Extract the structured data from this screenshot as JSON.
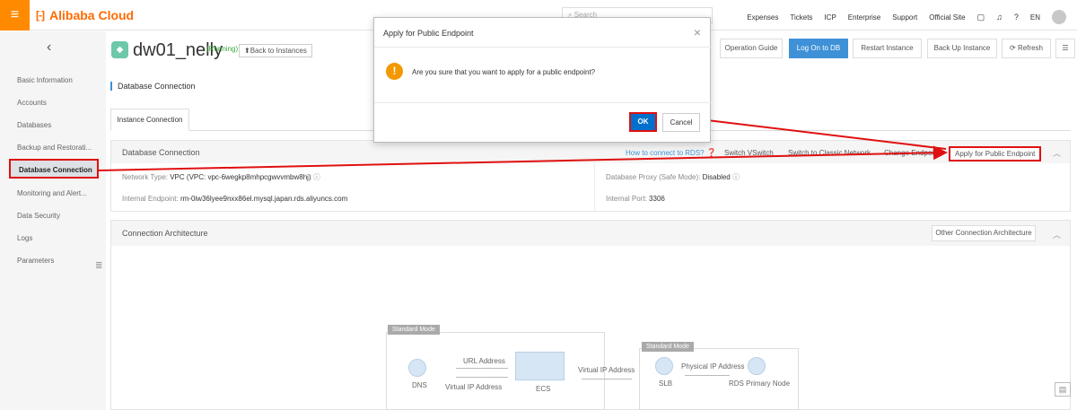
{
  "top": {
    "menu_glyph": "≡",
    "brand": "Alibaba Cloud",
    "brand_mark": "[-]",
    "search_placeholder": "Search",
    "nav": [
      "Expenses",
      "Tickets",
      "ICP",
      "Enterprise",
      "Support",
      "Official Site"
    ],
    "lang": "EN"
  },
  "sidebar": {
    "back_glyph": "‹",
    "items": [
      "Basic Information",
      "Accounts",
      "Databases",
      "Backup and Restorati...",
      "Database Connection",
      "Monitoring and Alert...",
      "Data Security",
      "Logs",
      "Parameters"
    ],
    "list_glyph": "≣"
  },
  "instance": {
    "name": "dw01_nelly",
    "status": "(Running)",
    "back_label": "⬆Back to Instances"
  },
  "toolbar": {
    "guide": "Operation Guide",
    "logon": "Log On to DB",
    "restart": "Restart Instance",
    "backup": "Back Up Instance",
    "refresh": "⟳ Refresh",
    "more": "☰"
  },
  "page": {
    "section_title": "Database Connection",
    "tab": "Instance Connection"
  },
  "db_panel": {
    "title": "Database Connection",
    "how_to": "How to connect to RDS?",
    "switch_vswitch": "Switch VSwitch",
    "switch_classic": "Switch to Classic Network",
    "change_endpoint": "Change Endpoint",
    "apply_public": "Apply for Public Endpoint",
    "network_type_label": "Network Type:",
    "network_type_value": "VPC",
    "vpc_value": "(VPC:  vpc-6wegkp8mhpcgwvvmbw8hj)",
    "proxy_label": "Database Proxy (Safe Mode):",
    "proxy_value": "Disabled",
    "internal_endpoint_label": "Internal Endpoint:",
    "internal_endpoint_value": "rm-0iw36lyee9nxx86el.mysql.japan.rds.aliyuncs.com",
    "internal_port_label": "Internal Port:",
    "internal_port_value": "3306"
  },
  "arch_panel": {
    "title": "Connection Architecture",
    "other": "Other Connection Architecture",
    "standard_mode_left": "Standard Mode",
    "standard_mode_right": "Standard Mode",
    "dns": "DNS",
    "url_address": "URL Address",
    "virtual_ip_left": "Virtual IP Address",
    "ecs": "ECS",
    "virtual_ip_right": "Virtual IP Address",
    "slb": "SLB",
    "physical_ip": "Physical IP Address",
    "rds_primary": "RDS Primary Node"
  },
  "modal": {
    "title": "Apply for Public Endpoint",
    "message": "Are you sure that you want to apply for a public endpoint?",
    "ok": "OK",
    "cancel": "Cancel",
    "close_glyph": "×",
    "warn_glyph": "!"
  },
  "colors": {
    "brand": "#ff6a00",
    "primary": "#0070cc",
    "highlight": "#e01010",
    "warning": "#f39800"
  }
}
